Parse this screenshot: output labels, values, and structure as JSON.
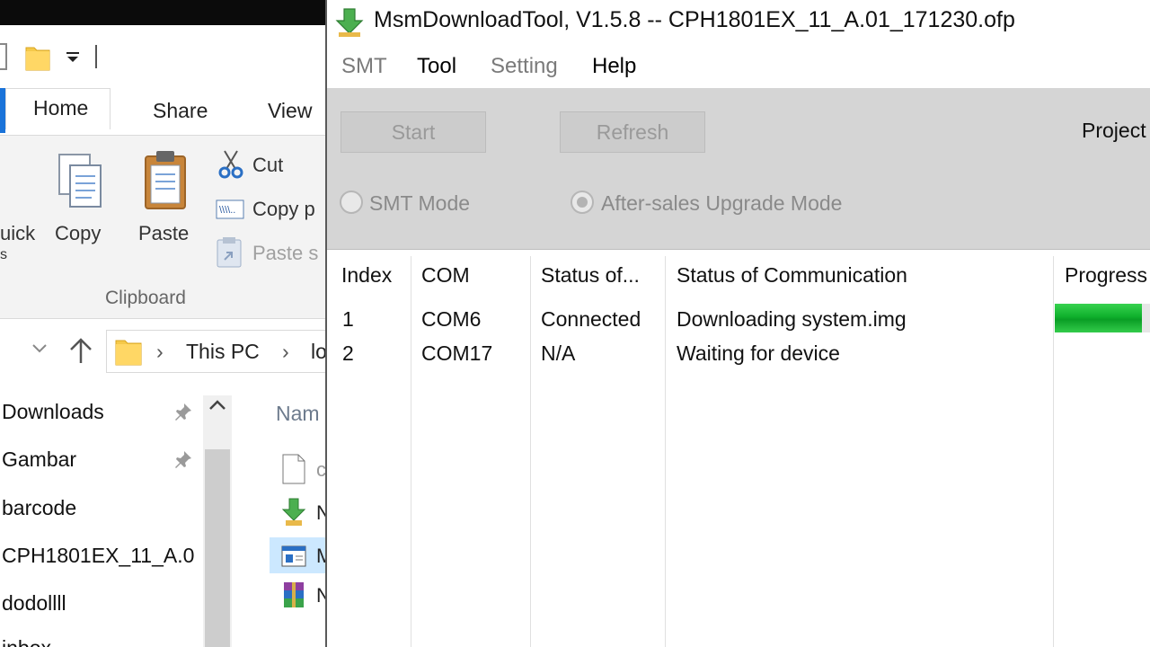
{
  "explorer": {
    "ribbon_tabs": [
      "Home",
      "Share",
      "View"
    ],
    "ribbon": {
      "quick_partial": "uick",
      "quick_partial2": "s",
      "copy": "Copy",
      "paste": "Paste",
      "cut": "Cut",
      "copy_path": "Copy p",
      "paste_shortcut": "Paste s",
      "group": "Clipboard"
    },
    "address": {
      "crumb1": "This PC",
      "crumb2": "lo"
    },
    "nav_items": [
      {
        "label": "Downloads",
        "pinned": true
      },
      {
        "label": "Gambar",
        "pinned": true
      },
      {
        "label": "barcode",
        "pinned": false
      },
      {
        "label": "CPH1801EX_11_A.0",
        "pinned": false
      },
      {
        "label": "dodollll",
        "pinned": false
      },
      {
        "label": "inbox",
        "pinned": false
      }
    ],
    "content": {
      "column_name": "Nam",
      "file_partials": [
        "c",
        "N",
        "M",
        "N"
      ]
    }
  },
  "msm": {
    "title": "MsmDownloadTool, V1.5.8 -- CPH1801EX_11_A.01_171230.ofp",
    "menu": [
      "SMT",
      "Tool",
      "Setting",
      "Help"
    ],
    "buttons": {
      "start": "Start",
      "refresh": "Refresh"
    },
    "project_label": "Project",
    "modes": {
      "smt": "SMT Mode",
      "aftersales": "After-sales Upgrade Mode",
      "selected": "aftersales"
    },
    "table": {
      "headers": [
        "Index",
        "COM",
        "Status of...",
        "Status of Communication",
        "Progress"
      ],
      "rows": [
        {
          "index": "1",
          "com": "COM6",
          "status": "Connected",
          "comm": "Downloading system.img",
          "progress": 0.9
        },
        {
          "index": "2",
          "com": "COM17",
          "status": "N/A",
          "comm": "Waiting for device",
          "progress": 0
        }
      ]
    }
  },
  "colors": {
    "progress_green": "#0fb02c",
    "active_tab_accent": "#1a73d9",
    "selection_blue": "#cce8ff"
  }
}
